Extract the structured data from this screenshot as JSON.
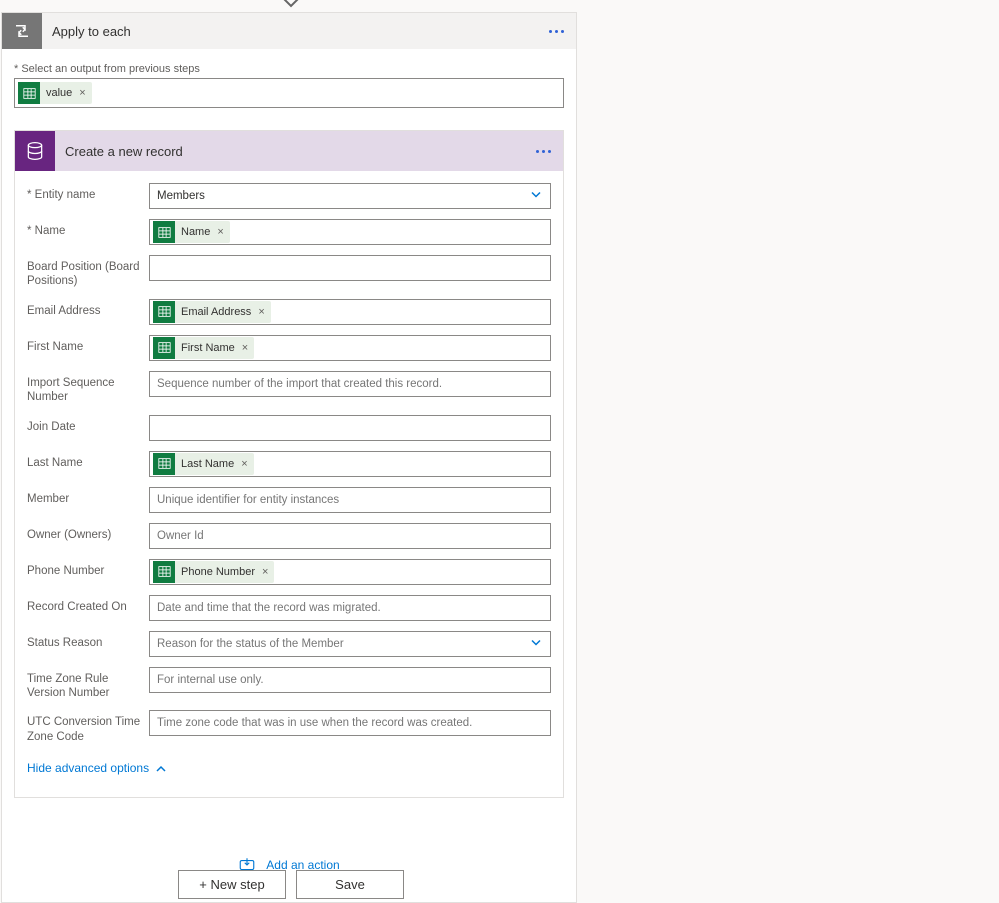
{
  "arrow": "→",
  "outer": {
    "title": "Apply to each",
    "select_label": "* Select an output from previous steps",
    "token_label": "value"
  },
  "inner": {
    "title": "Create a new record",
    "hide_advanced": "Hide advanced options"
  },
  "fields": {
    "entity_name_label": "* Entity name",
    "entity_name_value": "Members",
    "name_label": "* Name",
    "name_token": "Name",
    "board_label": "Board Position (Board Positions)",
    "email_label": "Email Address",
    "email_token": "Email Address",
    "first_label": "First Name",
    "first_token": "First Name",
    "import_label": "Import Sequence Number",
    "import_placeholder": "Sequence number of the import that created this record.",
    "join_label": "Join Date",
    "last_label": "Last Name",
    "last_token": "Last Name",
    "member_label": "Member",
    "member_placeholder": "Unique identifier for entity instances",
    "owner_label": "Owner (Owners)",
    "owner_placeholder": "Owner Id",
    "phone_label": "Phone Number",
    "phone_token": "Phone Number",
    "created_label": "Record Created On",
    "created_placeholder": "Date and time that the record was migrated.",
    "status_label": "Status Reason",
    "status_placeholder": "Reason for the status of the Member",
    "tz_rule_label": "Time Zone Rule Version Number",
    "tz_rule_placeholder": "For internal use only.",
    "utc_label": "UTC Conversion Time Zone Code",
    "utc_placeholder": "Time zone code that was in use when the record was created."
  },
  "add_action": "Add an action",
  "footer": {
    "new_step": "+ New step",
    "save": "Save"
  }
}
